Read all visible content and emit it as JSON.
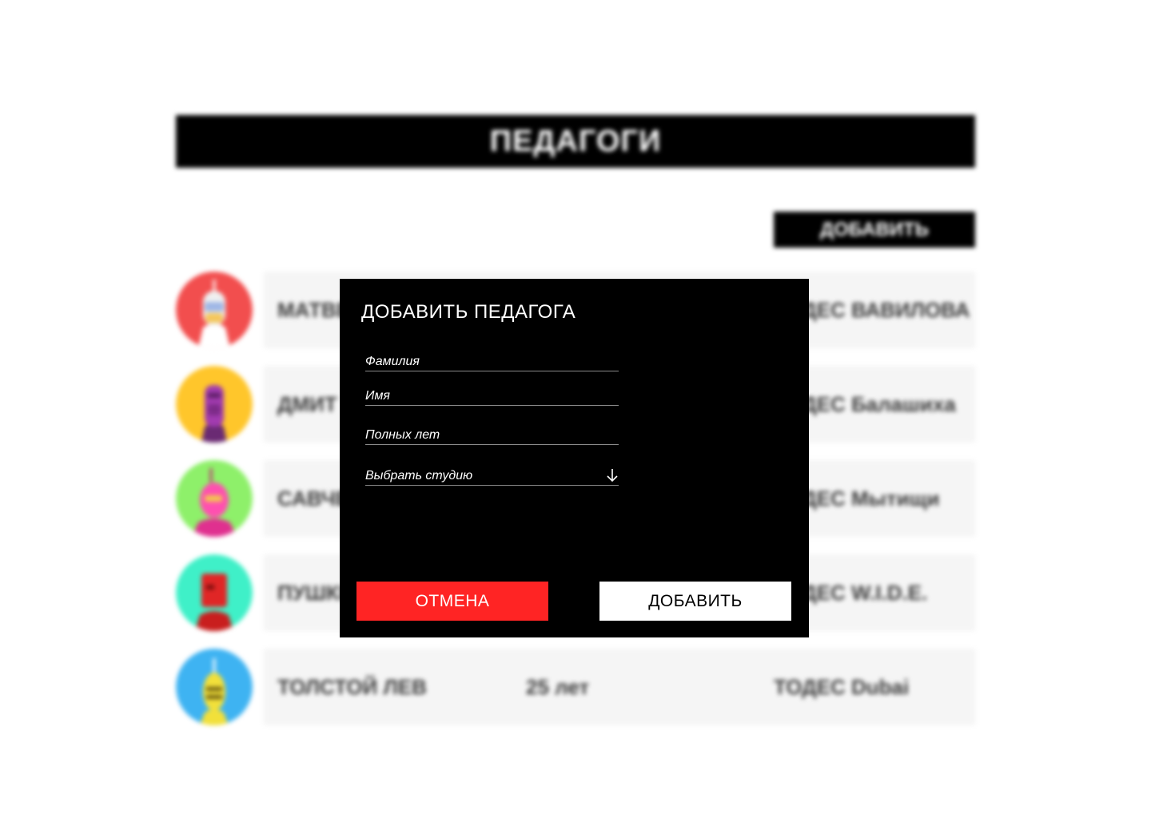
{
  "page": {
    "title": "ПЕДАГОГИ",
    "add_button_label": "ДОБАВИТЬ"
  },
  "teachers": [
    {
      "name": "МАТВЕ",
      "age": "",
      "studio": "ТОДЕС ВАВИЛОВА",
      "avatar_color": "#f24e4e"
    },
    {
      "name": "ДМИТ",
      "age": "",
      "studio": "ТОДЕС Балашиха",
      "avatar_color": "#ffc62b"
    },
    {
      "name": "САВЧЕ",
      "age": "",
      "studio": "ТОДЕС Мытищи",
      "avatar_color": "#8ef06a"
    },
    {
      "name": "ПУШКИ",
      "age": "",
      "studio": "ТОДЕС W.I.D.E.",
      "avatar_color": "#3ff0c8"
    },
    {
      "name": "ТОЛСТОЙ ЛЕВ",
      "age": "25 лет",
      "studio": "ТОДЕС Dubai",
      "avatar_color": "#3eb3f2"
    }
  ],
  "modal": {
    "title": "ДОБАВИТЬ ПЕДАГОГА",
    "fields": {
      "last_name": "Фамилия",
      "first_name": "Имя",
      "age": "Полных лет",
      "studio": "Выбрать студию"
    },
    "cancel_label": "ОТМЕНА",
    "add_label": "ДОБАВИТЬ",
    "studio_icon": "arrow-down-icon"
  },
  "colors": {
    "modal_bg": "#000000",
    "cancel": "#ff2424",
    "add": "#ffffff"
  }
}
